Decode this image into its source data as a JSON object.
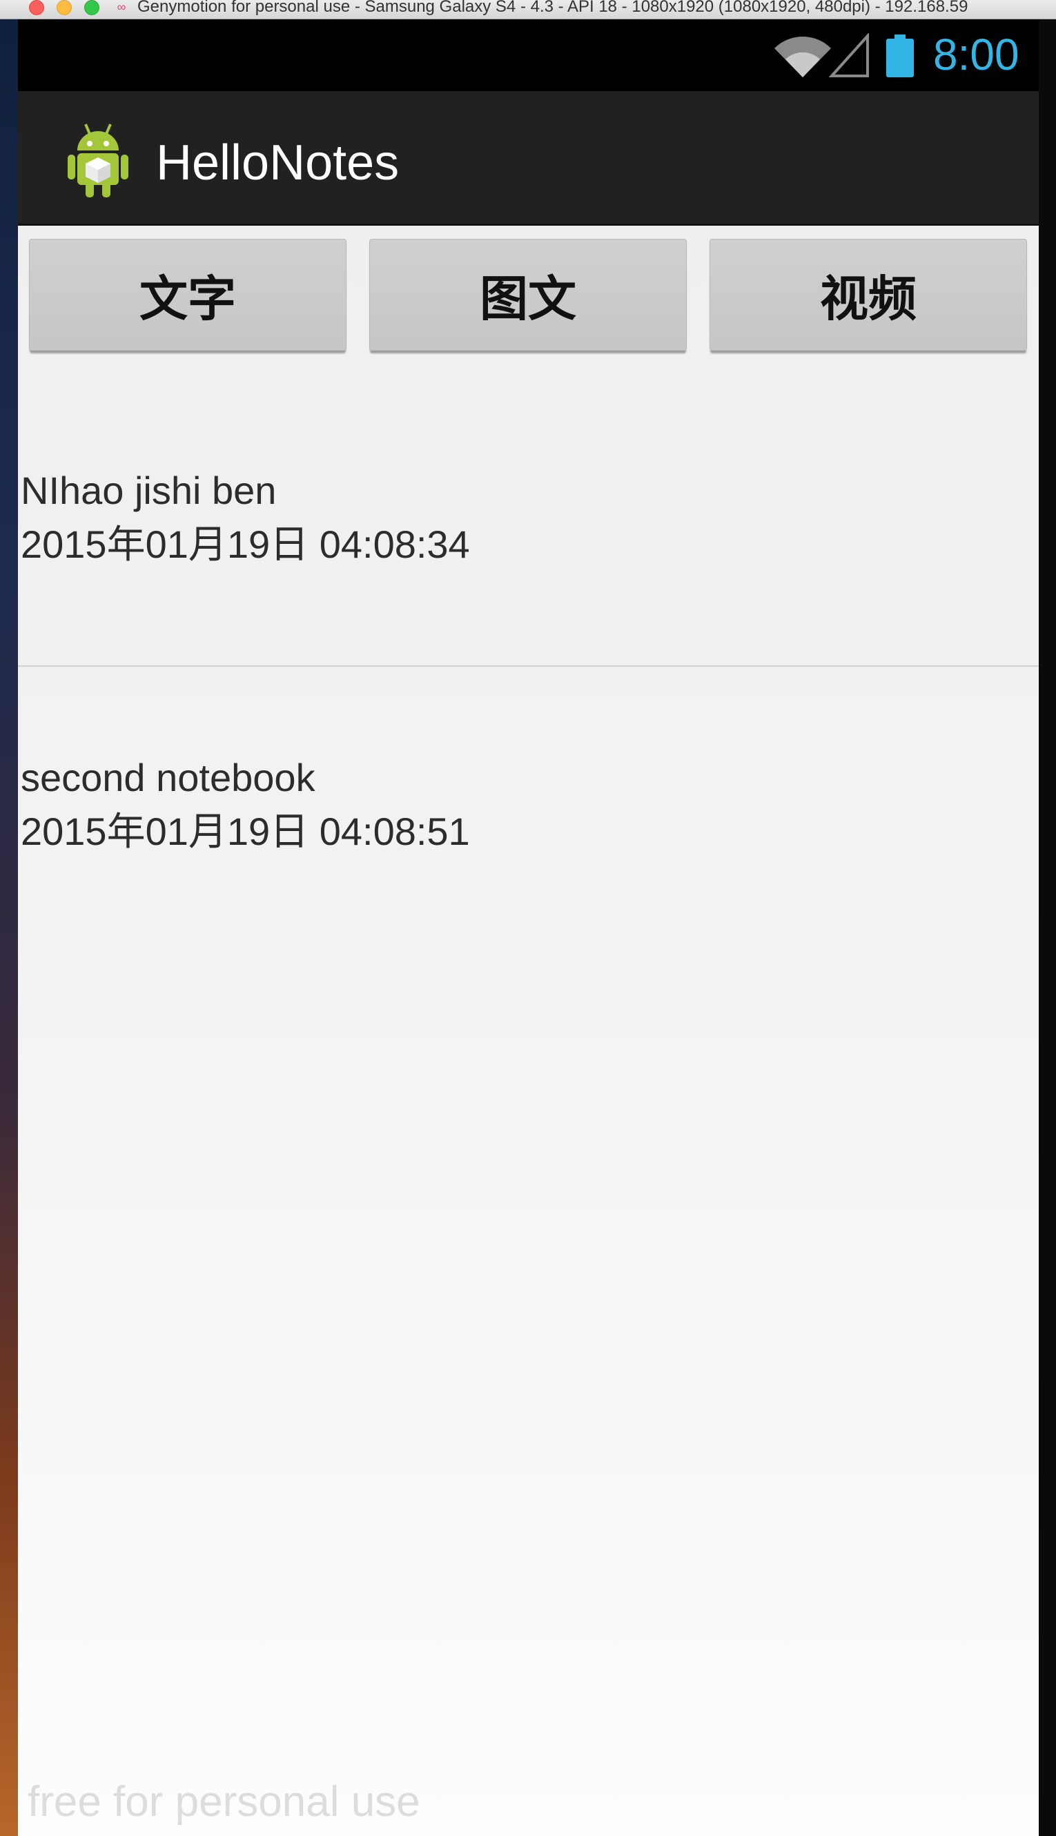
{
  "window": {
    "title": "Genymotion for personal use - Samsung Galaxy S4 - 4.3 - API 18 - 1080x1920 (1080x1920, 480dpi) - 192.168.59",
    "icon": "genymotion-logo-icon"
  },
  "status_bar": {
    "time": "8:00",
    "time_color": "#33b5e5",
    "icons": [
      "wifi-icon",
      "cell-signal-icon",
      "battery-icon"
    ]
  },
  "action_bar": {
    "app_title": "HelloNotes",
    "app_icon": "android-robot-icon",
    "background": "#212121"
  },
  "buttons": [
    {
      "label": "文字"
    },
    {
      "label": "图文"
    },
    {
      "label": "视频"
    }
  ],
  "notes": [
    {
      "title": "NIhao  jishi ben",
      "time": "2015年01月19日 04:08:34"
    },
    {
      "title": "second notebook",
      "time": "2015年01月19日 04:08:51"
    }
  ],
  "watermark": "free for personal use"
}
